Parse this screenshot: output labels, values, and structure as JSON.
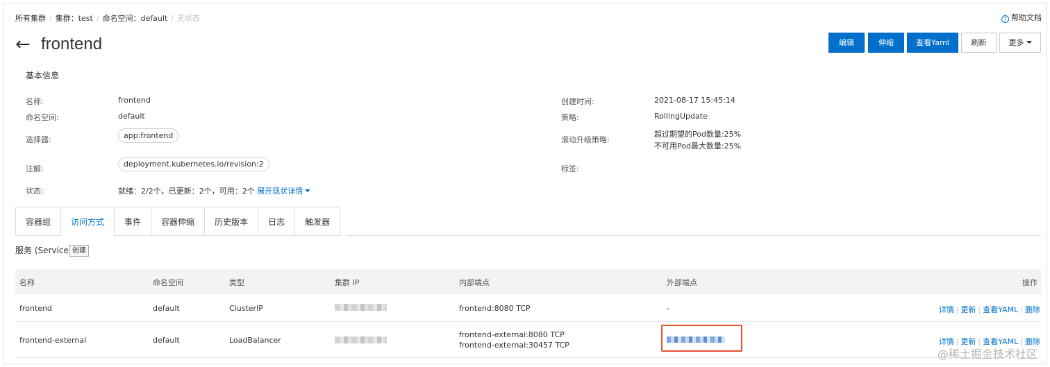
{
  "breadcrumb": {
    "all_clusters": "所有集群",
    "cluster": "集群：test",
    "namespace": "命名空间：default",
    "status": "无状态"
  },
  "help": {
    "label": "帮助文档"
  },
  "header": {
    "back_icon": "←",
    "title": "frontend",
    "buttons": {
      "edit": "编辑",
      "scale": "伸缩",
      "view_yaml": "查看Yaml",
      "refresh": "刷新",
      "more": "更多"
    }
  },
  "basic_info": {
    "section_title": "基本信息",
    "name_label": "名称:",
    "name_value": "frontend",
    "namespace_label": "命名空间:",
    "namespace_value": "default",
    "selector_label": "选择器:",
    "selector_tag": "app:frontend",
    "annotation_label": "注解:",
    "annotation_tag": "deployment.kubernetes.io/revision:2",
    "status_label": "状态:",
    "status_value": "就绪：2/2个，已更新：2个，可用：2个",
    "status_expand": "展开现状详情",
    "created_label": "创建时间:",
    "created_value": "2021-08-17 15:45:14",
    "strategy_label": "策略:",
    "strategy_value": "RollingUpdate",
    "rolling_label": "滚动升级策略:",
    "rolling_line1": "超过期望的Pod数量:25%",
    "rolling_line2": "不可用Pod最大数量:25%",
    "labels_label": "标签:"
  },
  "tabs": [
    "容器组",
    "访问方式",
    "事件",
    "容器伸缩",
    "历史版本",
    "日志",
    "触发器"
  ],
  "active_tab": "访问方式",
  "service": {
    "title": "服务 (Service)",
    "create_button": "创建",
    "columns": [
      "名称",
      "命名空间",
      "类型",
      "集群 IP",
      "内部端点",
      "外部端点",
      "操作"
    ],
    "rows": [
      {
        "name": "frontend",
        "namespace": "default",
        "type": "ClusterIP",
        "internal": [
          "frontend:8080 TCP"
        ],
        "external": "-",
        "ops": [
          "详情",
          "更新",
          "查看YAML",
          "删除"
        ]
      },
      {
        "name": "frontend-external",
        "namespace": "default",
        "type": "LoadBalancer",
        "internal": [
          "frontend-external:8080 TCP",
          "frontend-external:30457 TCP"
        ],
        "external": "",
        "ops": [
          "详情",
          "更新",
          "查看YAML",
          "删除"
        ]
      }
    ]
  },
  "watermark": "@稀土掘金技术社区",
  "colors": {
    "primary": "#0070cc",
    "highlight": "#e5502e"
  }
}
